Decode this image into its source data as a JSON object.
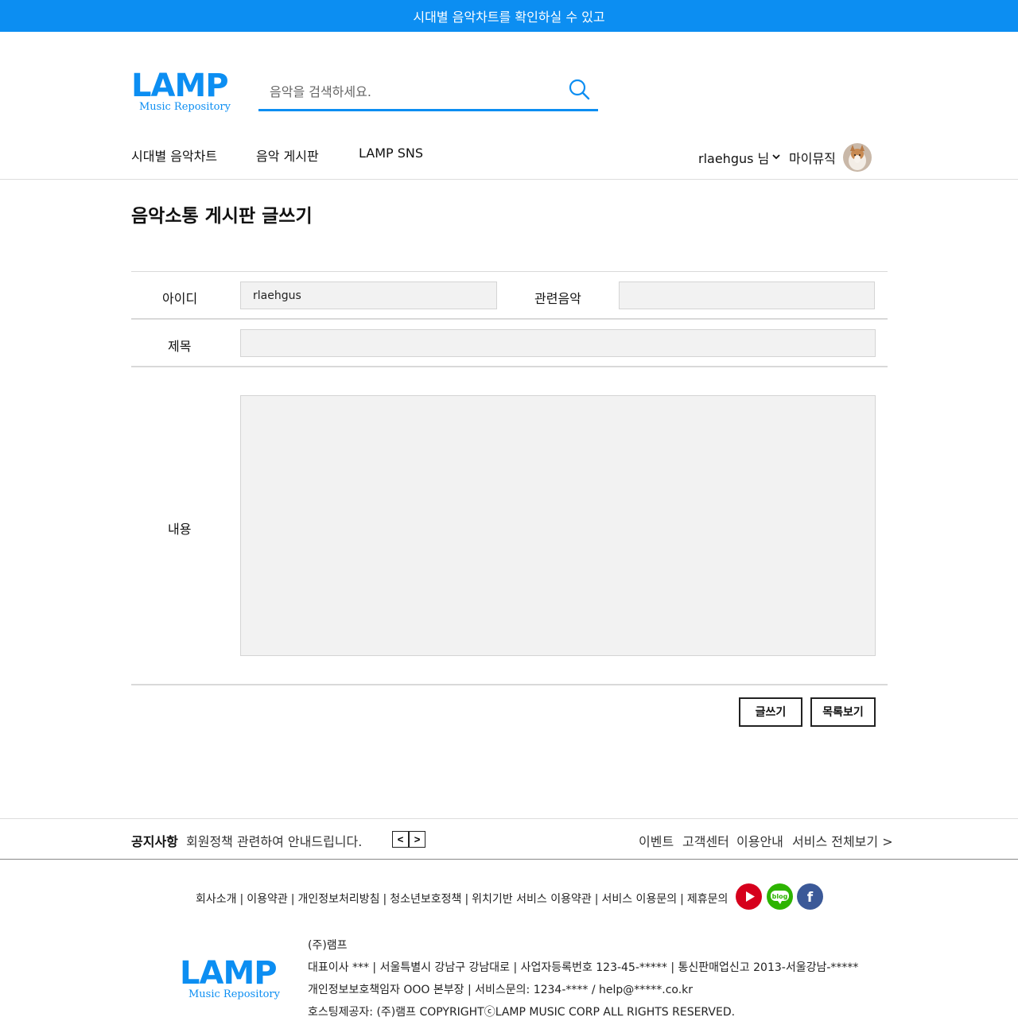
{
  "banner": {
    "text": "시대별 음악차트를 확인하실 수 있고"
  },
  "logo": {
    "title": "LAMP",
    "subtitle": "Music Repository"
  },
  "search": {
    "placeholder": "음악을 검색하세요.",
    "icon": "search-icon"
  },
  "nav": {
    "items": [
      {
        "label": "시대별 음악차트"
      },
      {
        "label": "음악 게시판"
      },
      {
        "label": "LAMP SNS"
      }
    ],
    "user": {
      "name": "rlaehgus 님",
      "my_music": "마이뮤직"
    }
  },
  "page": {
    "title": "음악소통 게시판 글쓰기"
  },
  "form": {
    "id_label": "아이디",
    "id_value": "rlaehgus",
    "music_label": "관련음악",
    "music_value": "",
    "title_label": "제목",
    "title_value": "",
    "content_label": "내용",
    "content_value": ""
  },
  "buttons": {
    "write": "글쓰기",
    "list": "목록보기"
  },
  "notice": {
    "title": "공지사항",
    "text": "회원정책 관련하여 안내드립니다.",
    "prev": "<",
    "next": ">"
  },
  "footer_menu": {
    "event": "이벤트",
    "cs": "고객센터",
    "guide": "이용안내",
    "all": "서비스 전체보기 >"
  },
  "footer_links": [
    "회사소개",
    "이용약관",
    "개인정보처리방침",
    "청소년보호정책",
    "위치기반 서비스 이용약관",
    "서비스 이용문의",
    "제휴문의"
  ],
  "social": {
    "youtube": "youtube-icon",
    "blog": "blog-icon",
    "blog_text": "blog",
    "facebook": "facebook-icon",
    "facebook_text": "f"
  },
  "company": {
    "name": "(주)램프",
    "line1": "대표이사 *** | 서울특별시 강남구 강남대로 | 사업자등록번호 123-45-***** | 통신판매업신고 2013-서울강남-*****",
    "line2": "개인정보보호책임자 OOO 본부장 | 서비스문의: 1234-**** / help@*****.co.kr",
    "line3": "호스팅제공자: (주)램프 COPYRIGHTⓒLAMP MUSIC CORP ALL RIGHTS RESERVED."
  },
  "colors": {
    "brand": "#0c8ef2",
    "field_bg": "#f2f2f2"
  }
}
